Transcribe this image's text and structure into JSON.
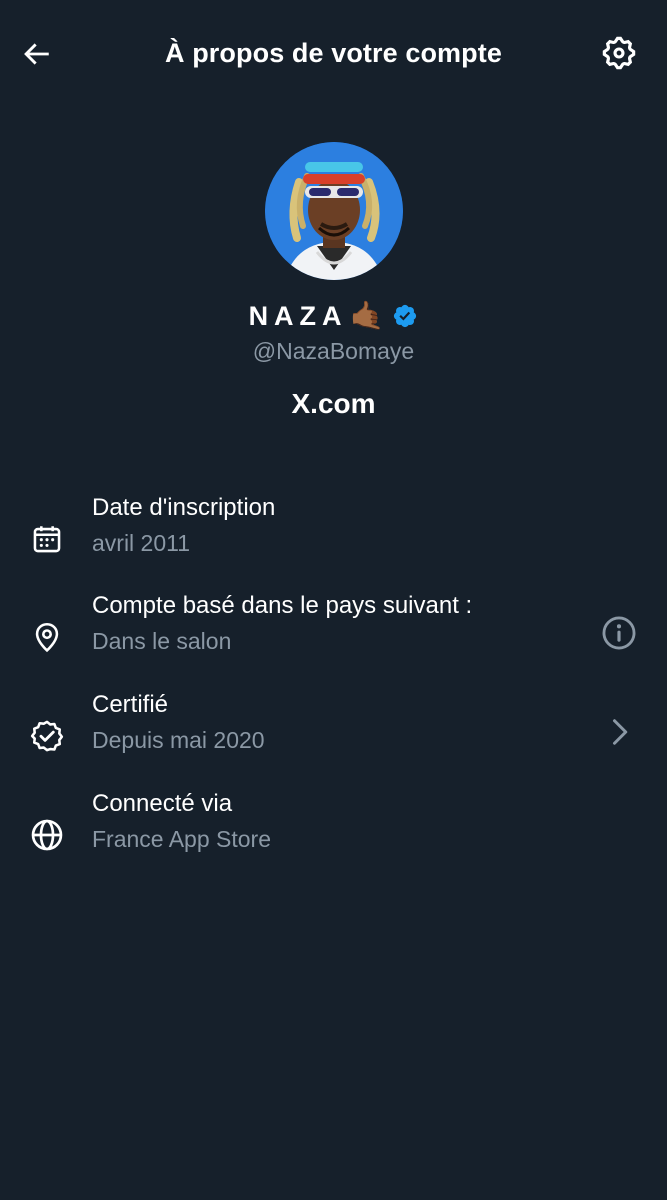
{
  "header": {
    "title": "À propos de votre compte",
    "back_icon": "arrow-left-icon",
    "settings_icon": "gear-icon"
  },
  "profile": {
    "display_name": "NAZA",
    "emoji": "🤙🏾",
    "verified": true,
    "handle": "@NazaBomaye",
    "site": "X.com"
  },
  "rows": [
    {
      "icon": "calendar-icon",
      "title": "Date d'inscription",
      "value": "avril 2011"
    },
    {
      "icon": "location-pin-icon",
      "title": "Compte basé dans le pays suivant :",
      "value": "Dans le salon",
      "action_icon": "info-icon"
    },
    {
      "icon": "verified-badge-outline-icon",
      "title": "Certifié",
      "value": "Depuis mai 2020",
      "action_icon": "chevron-right-icon"
    },
    {
      "icon": "globe-icon",
      "title": "Connecté via",
      "value": "France App Store"
    }
  ],
  "colors": {
    "background": "#16202b",
    "primary_text": "#ffffff",
    "secondary_text": "#8b98a5",
    "verified_blue": "#1d9bf0"
  }
}
